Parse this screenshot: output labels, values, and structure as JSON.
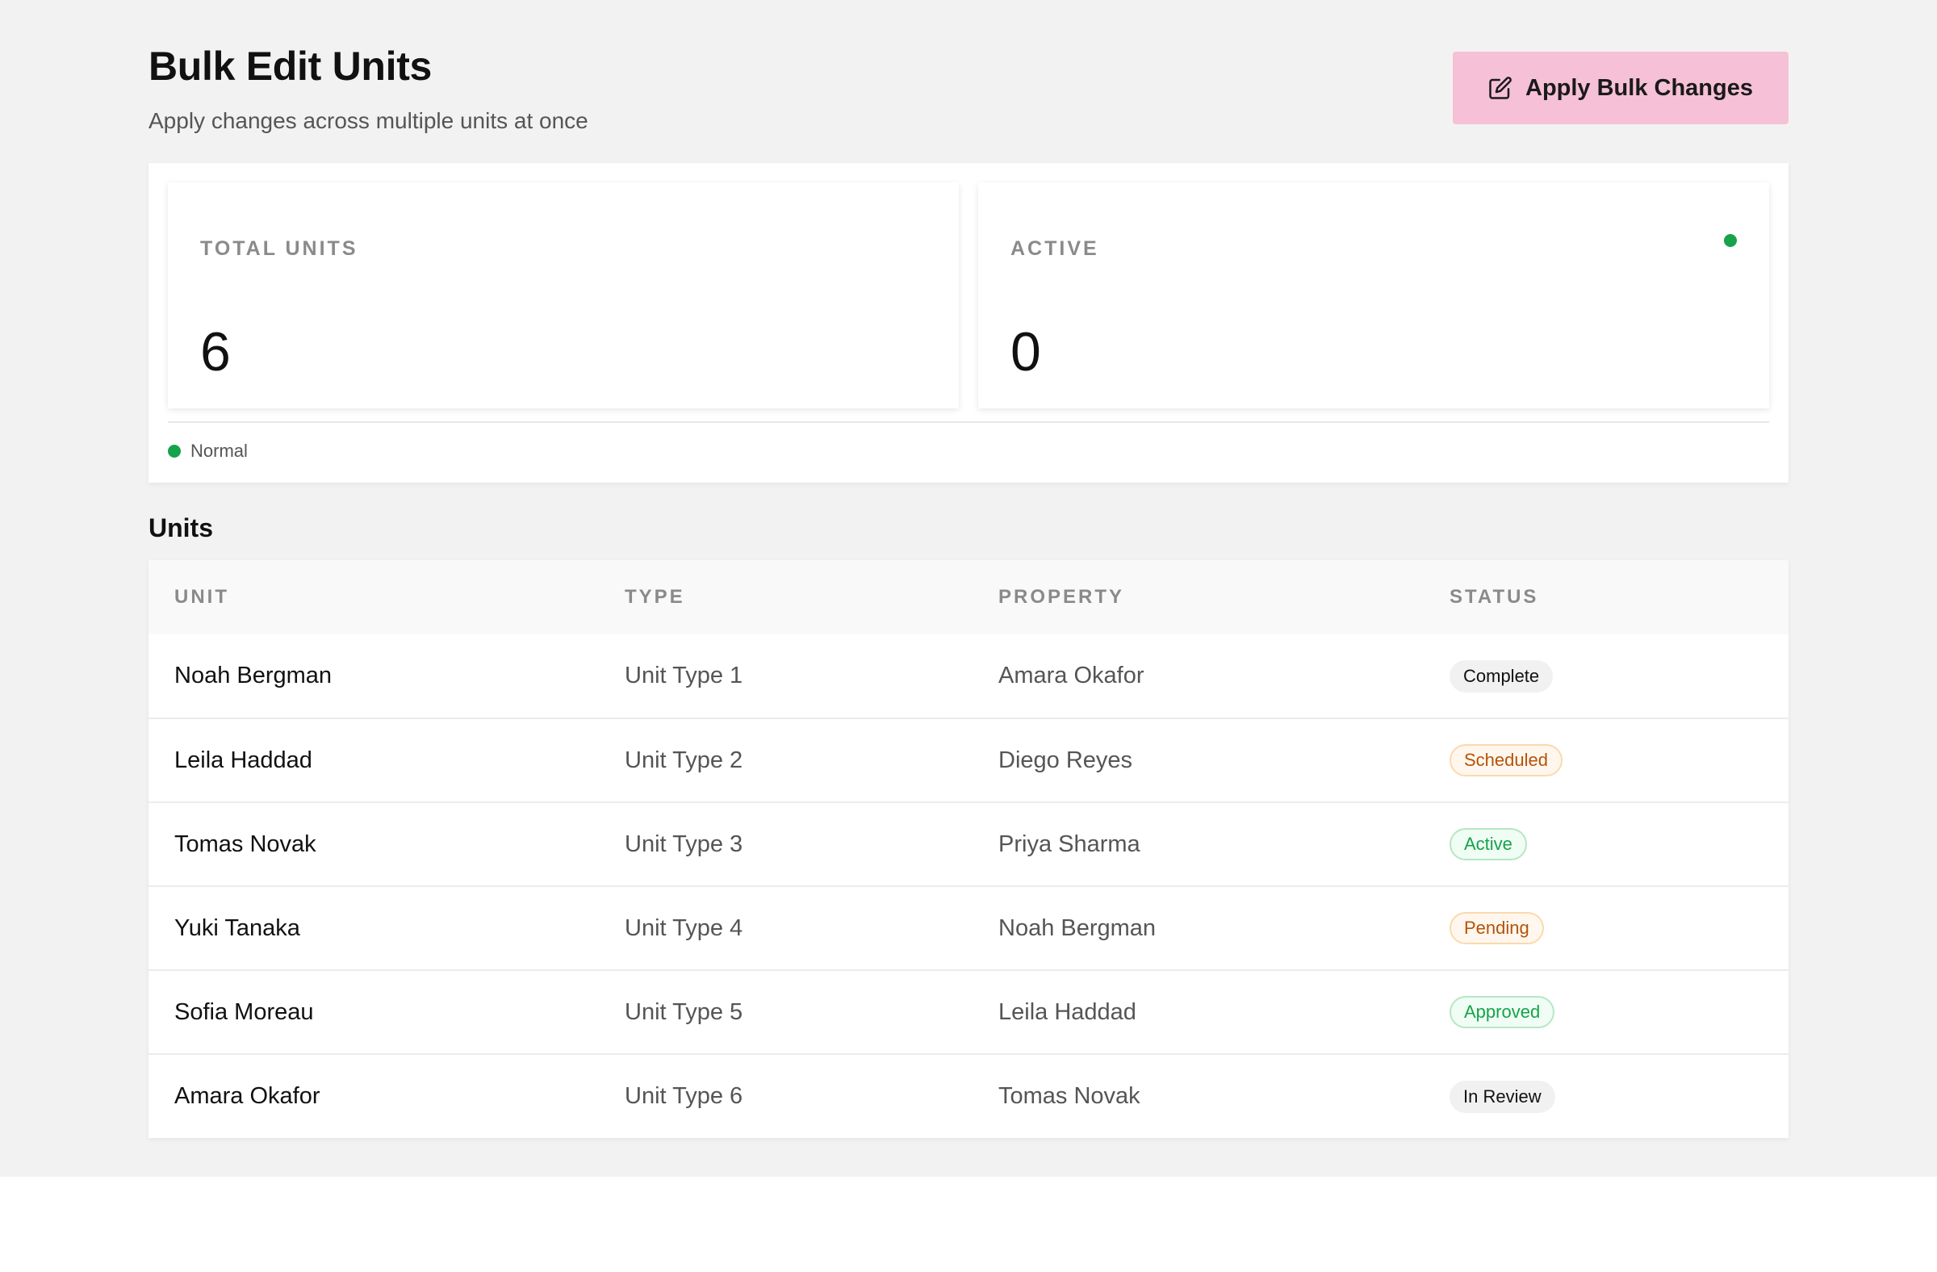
{
  "header": {
    "title": "Bulk Edit Units",
    "subtitle": "Apply changes across multiple units at once",
    "apply_button_label": "Apply Bulk Changes",
    "apply_button_icon": "edit-icon",
    "apply_button_color": "#f6c0d6"
  },
  "stats": {
    "total_units": {
      "label": "TOTAL UNITS",
      "value": "6"
    },
    "active": {
      "label": "ACTIVE",
      "value": "0",
      "indicator_color": "#16a34a"
    },
    "legend": {
      "label": "Normal",
      "color": "#16a34a"
    }
  },
  "units": {
    "section_title": "Units",
    "columns": [
      "UNIT",
      "TYPE",
      "PROPERTY",
      "STATUS"
    ],
    "rows": [
      {
        "unit": "Noah Bergman",
        "type": "Unit Type 1",
        "property": "Amara Okafor",
        "status": "Complete",
        "status_kind": "neutral"
      },
      {
        "unit": "Leila Haddad",
        "type": "Unit Type 2",
        "property": "Diego Reyes",
        "status": "Scheduled",
        "status_kind": "warning"
      },
      {
        "unit": "Tomas Novak",
        "type": "Unit Type 3",
        "property": "Priya Sharma",
        "status": "Active",
        "status_kind": "success"
      },
      {
        "unit": "Yuki Tanaka",
        "type": "Unit Type 4",
        "property": "Noah Bergman",
        "status": "Pending",
        "status_kind": "warning"
      },
      {
        "unit": "Sofia Moreau",
        "type": "Unit Type 5",
        "property": "Leila Haddad",
        "status": "Approved",
        "status_kind": "success"
      },
      {
        "unit": "Amara Okafor",
        "type": "Unit Type 6",
        "property": "Tomas Novak",
        "status": "In Review",
        "status_kind": "neutral"
      }
    ]
  },
  "colors": {
    "page_background": "#f2f2f2",
    "success": "#16a34a",
    "warning": "#b45309"
  }
}
